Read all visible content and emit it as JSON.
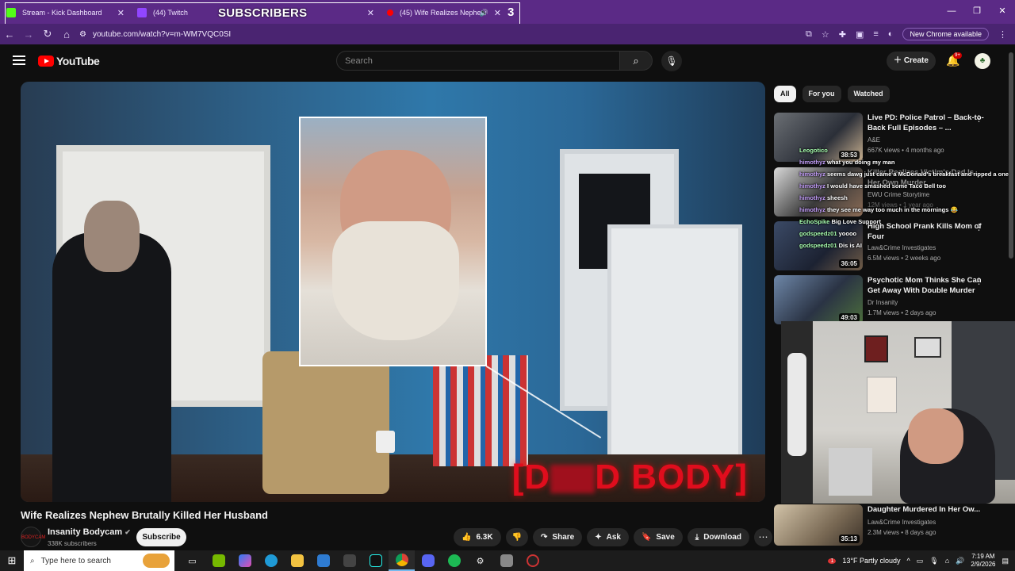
{
  "browser": {
    "tabs": [
      {
        "label": "Stream - Kick Dashboard",
        "color": "#53fc18"
      },
      {
        "label": "(44) Twitch",
        "color": "#9146ff"
      },
      {
        "label": "(45) Wife Realizes Nephew",
        "color": "#ff0000"
      }
    ],
    "overlay_text": "SUBSCRIBERS",
    "overlay_count": "3",
    "url": "youtube.com/watch?v=m-WM7VQC0SI",
    "new_chrome": "New Chrome available"
  },
  "youtube": {
    "logo_text": "YouTube",
    "search_placeholder": "Search",
    "create_label": "Create",
    "notif_badge": "9+",
    "video": {
      "red_text_left": "[D",
      "red_text_right": "D BODY]",
      "title": "Wife Realizes Nephew Brutally Killed Her Husband",
      "channel": "Insanity Bodycam",
      "channel_avatar_text": "BODYCAM",
      "subscribers": "338K subscribers",
      "subscribe_label": "Subscribe",
      "likes": "6.3K",
      "share": "Share",
      "ask": "Ask",
      "save": "Save",
      "download": "Download"
    },
    "chips": [
      "All",
      "For you",
      "Watched"
    ],
    "recommendations": [
      {
        "title": "Live PD: Police Patrol – Back-to-Back Full Episodes – ...",
        "channel": "A&E",
        "meta": "667K views • 4 months ago",
        "duration": "38:53"
      },
      {
        "title": "Killer Realizes Victim's Dad Is Her Own Murder",
        "channel": "EWU Crime Storytime",
        "meta": "12M views • 1 year ago",
        "duration": ""
      },
      {
        "title": "High School Prank Kills Mom of Four",
        "channel": "Law&Crime Investigates",
        "meta": "6.5M views • 2 weeks ago",
        "duration": "36:05"
      },
      {
        "title": "Psychotic Mom Thinks She Can Get Away With Double Murder",
        "channel": "Dr Insanity",
        "meta": "1.7M views • 2 days ago",
        "duration": "49:03"
      },
      {
        "title": "Daughter Murdered In Her Ow...",
        "channel": "Law&Crime Investigates",
        "meta": "2.3M views • 8 days ago",
        "duration": "35:13"
      }
    ],
    "chat": [
      {
        "user": "Leogotico",
        "msg": ""
      },
      {
        "user": "himothyz",
        "msg": "what you doing my man"
      },
      {
        "user": "himothyz",
        "msg": "seems dawg just came a McDonald's breakfast and ripped a one"
      },
      {
        "user": "himothyz",
        "msg": "I would have smashed some Taco Bell too"
      },
      {
        "user": "himothyz",
        "msg": "sheesh"
      },
      {
        "user": "himothyz",
        "msg": "they see me way too much in the mornings 😂"
      },
      {
        "user": "EchoSpike",
        "msg": "Big Love Support"
      },
      {
        "user": "godspeedz01",
        "msg": "yoooo"
      },
      {
        "user": "godspeedz01",
        "msg": "Dis is AI"
      }
    ]
  },
  "taskbar": {
    "search_placeholder": "Type here to search",
    "weather": "13°F  Partly cloudy",
    "time": "7:19 AM",
    "date": "2/9/2026",
    "weather_badge": "1"
  }
}
